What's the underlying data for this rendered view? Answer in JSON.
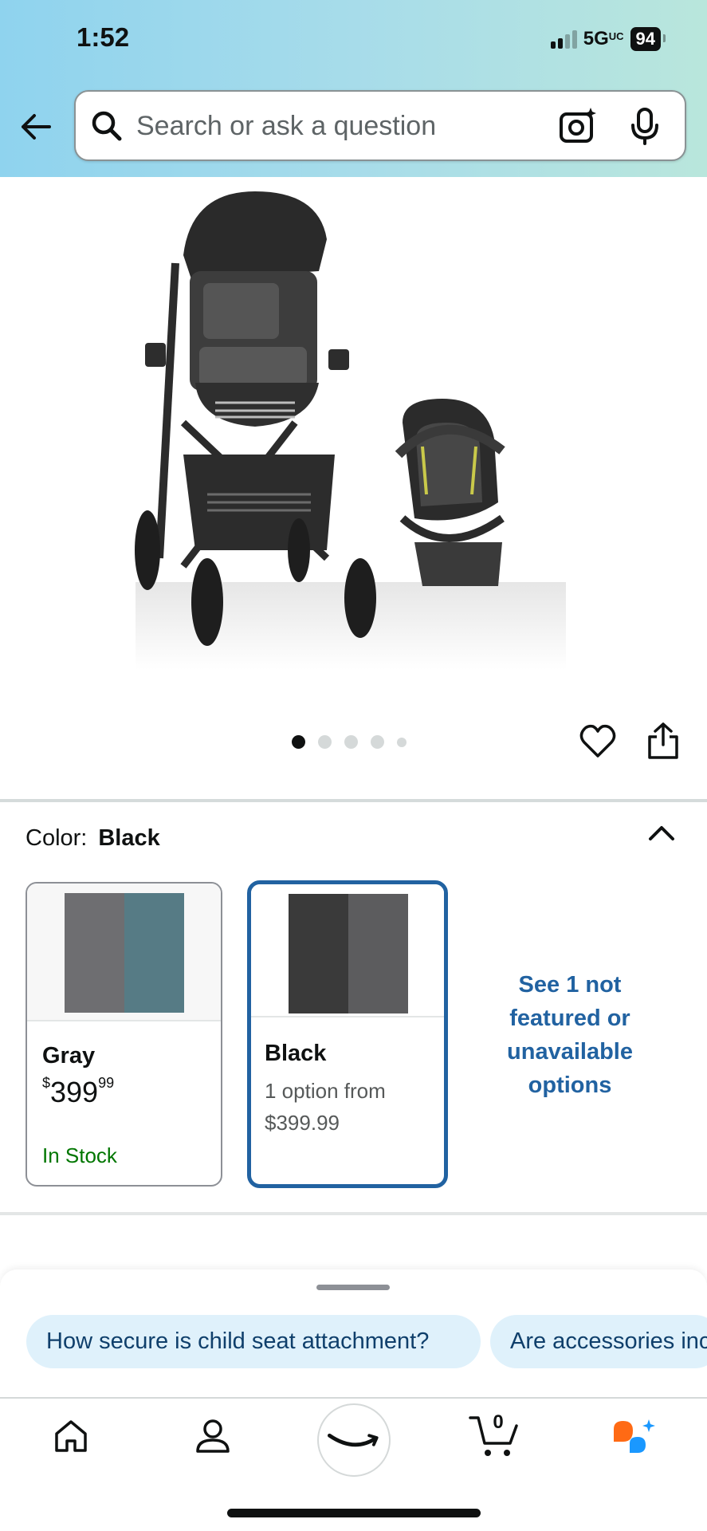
{
  "status_bar": {
    "time": "1:52",
    "network": "5G",
    "network_suffix": "UC",
    "battery": "94"
  },
  "search": {
    "placeholder": "Search or ask a question"
  },
  "icons": {
    "back": "back-arrow-icon",
    "search": "search-icon",
    "lens": "camera-lens-icon",
    "mic": "microphone-icon",
    "heart": "heart-icon",
    "share": "share-icon",
    "collapse": "chevron-up-icon"
  },
  "carousel": {
    "page_count": 5,
    "active_index": 0
  },
  "color_selector": {
    "label": "Color:",
    "selected_value": "Black",
    "options": [
      {
        "name": "Gray",
        "price_symbol": "$",
        "price_whole": "399",
        "price_fraction": "99",
        "availability": "In Stock",
        "swatch_colors": [
          "#6e6e71",
          "#567b85"
        ],
        "selected": false
      },
      {
        "name": "Black",
        "option_text": "1 option from",
        "option_price": "$399.99",
        "swatch_colors": [
          "#3a3a3a",
          "#5c5c5e"
        ],
        "selected": true
      }
    ],
    "see_more": "See 1 not featured or unavailable options"
  },
  "suggestions": [
    "How secure is child seat attachment?",
    "Are accessories included?"
  ],
  "bottom_nav": {
    "items": [
      "home-icon",
      "profile-icon",
      "amazon-smile-icon",
      "cart-icon",
      "rufus-icon"
    ],
    "cart_count": "0"
  },
  "colors": {
    "accent_blue": "#2162a1",
    "in_stock_green": "#007600",
    "chip_bg": "#dff1fb",
    "rufus_orange": "#ff6a14",
    "rufus_blue": "#1a98ff"
  }
}
